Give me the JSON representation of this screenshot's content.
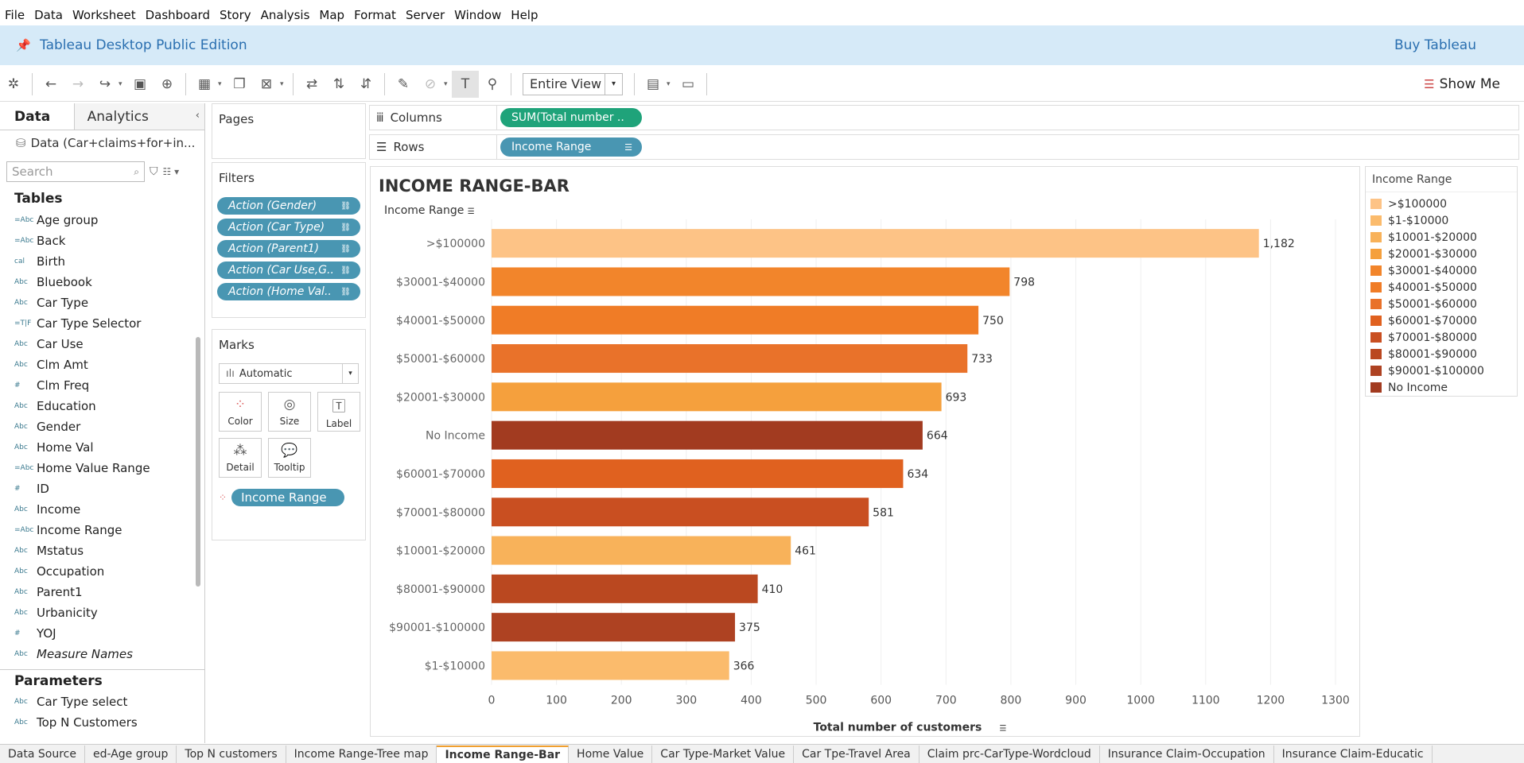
{
  "menu": [
    "File",
    "Data",
    "Worksheet",
    "Dashboard",
    "Story",
    "Analysis",
    "Map",
    "Format",
    "Server",
    "Window",
    "Help"
  ],
  "banner": {
    "title": "Tableau Desktop Public Edition",
    "buy": "Buy Tableau"
  },
  "toolbar": {
    "fit": "Entire View",
    "show_me": "Show Me"
  },
  "left": {
    "tab_data": "Data",
    "tab_analytics": "Analytics",
    "datasource": "Data (Car+claims+for+in...",
    "search_placeholder": "Search",
    "tables_head": "Tables",
    "fields": [
      {
        "type": "=Abc",
        "name": "Age group"
      },
      {
        "type": "=Abc",
        "name": "Back"
      },
      {
        "type": "cal",
        "name": "Birth"
      },
      {
        "type": "Abc",
        "name": "Bluebook"
      },
      {
        "type": "Abc",
        "name": "Car Type"
      },
      {
        "type": "=T|F",
        "name": "Car Type Selector"
      },
      {
        "type": "Abc",
        "name": "Car Use"
      },
      {
        "type": "Abc",
        "name": "Clm Amt"
      },
      {
        "type": "#",
        "name": "Clm Freq"
      },
      {
        "type": "Abc",
        "name": "Education"
      },
      {
        "type": "Abc",
        "name": "Gender"
      },
      {
        "type": "Abc",
        "name": "Home Val"
      },
      {
        "type": "=Abc",
        "name": "Home Value Range"
      },
      {
        "type": "#",
        "name": "ID"
      },
      {
        "type": "Abc",
        "name": "Income"
      },
      {
        "type": "=Abc",
        "name": "Income Range"
      },
      {
        "type": "Abc",
        "name": "Mstatus"
      },
      {
        "type": "Abc",
        "name": "Occupation"
      },
      {
        "type": "Abc",
        "name": "Parent1"
      },
      {
        "type": "Abc",
        "name": "Urbanicity"
      },
      {
        "type": "#",
        "name": "YOJ"
      },
      {
        "type": "Abc",
        "name": "Measure Names"
      }
    ],
    "params_head": "Parameters",
    "params": [
      {
        "type": "Abc",
        "name": "Car Type select"
      },
      {
        "type": "Abc",
        "name": "Top N Customers"
      }
    ]
  },
  "shelves": {
    "pages": "Pages",
    "filters": "Filters",
    "filter_pills": [
      "Action (Gender)",
      "Action (Car Type)",
      "Action (Parent1)",
      "Action (Car Use,G..",
      "Action (Home Val.."
    ],
    "marks": "Marks",
    "mark_type": "Automatic",
    "mark_buttons": [
      "Color",
      "Size",
      "Label",
      "Detail",
      "Tooltip"
    ],
    "color_field": "Income Range",
    "columns_label": "Columns",
    "rows_label": "Rows",
    "columns_pill": "SUM(Total number ..",
    "rows_pill": "Income Range"
  },
  "chart_data": {
    "type": "bar",
    "title": "INCOME RANGE-BAR",
    "row_header": "Income Range",
    "xlabel": "Total number of customers",
    "categories": [
      ">$100000",
      "$30001-$40000",
      "$40001-$50000",
      "$50001-$60000",
      "$20001-$30000",
      "No Income",
      "$60001-$70000",
      "$70001-$80000",
      "$10001-$20000",
      "$80001-$90000",
      "$90001-$100000",
      "$1-$10000"
    ],
    "values": [
      1182,
      798,
      750,
      733,
      693,
      664,
      634,
      581,
      461,
      410,
      375,
      366
    ],
    "value_labels": [
      "1,182",
      "798",
      "750",
      "733",
      "693",
      "664",
      "634",
      "581",
      "461",
      "410",
      "375",
      "366"
    ],
    "colors": [
      "#fdc386",
      "#f2852b",
      "#f07c26",
      "#e9722a",
      "#f5a03d",
      "#a23b20",
      "#e0611f",
      "#c94f21",
      "#f8b25a",
      "#ba4820",
      "#ae4222",
      "#fbbb6c"
    ],
    "xlim": [
      0,
      1300
    ],
    "xticks": [
      0,
      100,
      200,
      300,
      400,
      500,
      600,
      700,
      800,
      900,
      1000,
      1100,
      1200,
      1300
    ]
  },
  "legend": {
    "title": "Income Range",
    "items": [
      {
        "label": ">$100000",
        "color": "#fdc386"
      },
      {
        "label": "$1-$10000",
        "color": "#fbbb6c"
      },
      {
        "label": "$10001-$20000",
        "color": "#f8b25a"
      },
      {
        "label": "$20001-$30000",
        "color": "#f5a03d"
      },
      {
        "label": "$30001-$40000",
        "color": "#f2852b"
      },
      {
        "label": "$40001-$50000",
        "color": "#f07c26"
      },
      {
        "label": "$50001-$60000",
        "color": "#e9722a"
      },
      {
        "label": "$60001-$70000",
        "color": "#e0611f"
      },
      {
        "label": "$70001-$80000",
        "color": "#c94f21"
      },
      {
        "label": "$80001-$90000",
        "color": "#ba4820"
      },
      {
        "label": "$90001-$100000",
        "color": "#ae4222"
      },
      {
        "label": "No Income",
        "color": "#a23b20"
      }
    ]
  },
  "bottom_tabs": [
    "Data Source",
    "ed-Age group",
    "Top N customers",
    "Income Range-Tree map",
    "Income Range-Bar",
    "Home Value",
    "Car Type-Market Value",
    "Car Tpe-Travel Area",
    "Claim prc-CarType-Wordcloud",
    "Insurance Claim-Occupation",
    "Insurance Claim-Educatic"
  ],
  "active_tab": "Income Range-Bar"
}
